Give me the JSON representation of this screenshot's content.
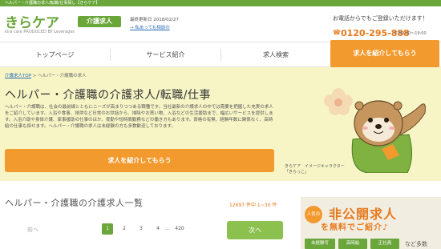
{
  "top_bar": {
    "text": "ヘルパー・介護職の求人/転職/仕事探し【きらケア】"
  },
  "header": {
    "logo_text": "きらケア",
    "logo_sub": "kira care   PRODUCED BY Leverages",
    "badge": "介護求人",
    "updated": "最終更新日 2018/02/27",
    "faq_link": "→ 私あっても相談の",
    "consult": "お電話からでもご登録いただけます！",
    "phone": "0120-295-888",
    "hours": "平日9:00〜19:00"
  },
  "nav": {
    "items": [
      "トップページ",
      "サービス紹介",
      "求人検索"
    ],
    "cta": "求人を紹介してもらう"
  },
  "breadcrumb": {
    "home": "介護求人TOP",
    "sep": ">",
    "current": "ヘルパー・介護職の求人"
  },
  "hero": {
    "title": "ヘルパー・介護職の介護求人/転職/仕事",
    "description": "ヘルパー・介護職は、社会の最前線とともにニーズが高まりつつある職種です。当社最新の介護求人の中では需要を把握した充実の求人をご紹介しています。入浴や食事、排泄など日常のお世話から、掃除やお買い物、入浴などの生活援助まで、幅広いサービスを提供します。入浴介助や身体介護、家事援助の仕事のほか、夜勤や短時間勤務などの働き方もあります。資格の有無、経験年数に関係なく、高時給の仕事も探せます。ヘルパー・介護職の求人は未経験の方も多数歓迎しております。",
    "button": "求人を紹介してもらう",
    "caption_1": "きらケア　イメージキャラクター",
    "caption_2": "「きらっこ」"
  },
  "listing": {
    "title": "ヘルパー・介護職の介護求人一覧",
    "count": "12697 件中  1~30 件",
    "prev": "前へ",
    "pages": [
      "1",
      "2",
      "3",
      "4",
      "…",
      "420"
    ],
    "next": "次へ"
  },
  "side": {
    "circle": "人気の",
    "heading": "非公開求人",
    "sub": "を無料でご紹介♪",
    "tags": [
      "未経験可",
      "高時給",
      "正社員"
    ],
    "more": "など多数"
  },
  "colors": {
    "brand_green": "#6aa63a",
    "accent_orange": "#f39a2e",
    "hero_bg": "#f7f5c6"
  }
}
